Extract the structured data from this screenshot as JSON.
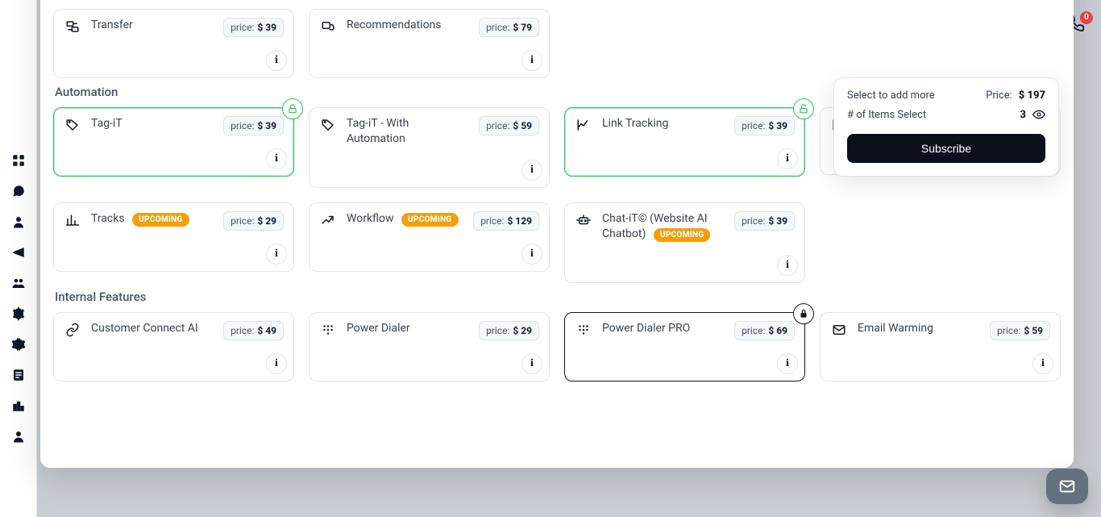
{
  "summary": {
    "select_label": "Select to add more",
    "price_label": "Price:",
    "price_value": "$ 197",
    "items_label": "# of Items Select",
    "items_value": "3",
    "subscribe_label": "Subscribe"
  },
  "badge_upcoming": "UPCOMING",
  "info_glyph": "i",
  "price_prefix": "price:",
  "sections": {
    "top_row1": [
      {
        "id": "blank1",
        "title": "",
        "price": ""
      },
      {
        "id": "blank2",
        "title": "",
        "price": ""
      },
      {
        "id": "blank3",
        "title": "",
        "price": ""
      },
      {
        "id": "blank4",
        "title": "",
        "price": ""
      }
    ],
    "top_row2": [
      {
        "id": "transfer",
        "title": "Transfer",
        "price": "$ 39"
      },
      {
        "id": "recommendations",
        "title": "Recommendations",
        "price": "$ 79"
      }
    ],
    "automation_title": "Automation",
    "automation": [
      {
        "id": "tagit",
        "title": "Tag-iT",
        "price": "$ 39",
        "selected": true
      },
      {
        "id": "tagit-auto",
        "title": "Tag-iT - With Automation",
        "price": "$ 59"
      },
      {
        "id": "link-tracking",
        "title": "Link Tracking",
        "price": "$ 39",
        "selected": true
      },
      {
        "id": "analytics",
        "title": "",
        "price": ""
      }
    ],
    "automation_row2": [
      {
        "id": "tracks",
        "title": "Tracks",
        "price": "$ 29",
        "upcoming": true
      },
      {
        "id": "workflow",
        "title": "Workflow",
        "price": "$ 129",
        "upcoming": true
      },
      {
        "id": "chatit",
        "title": "Chat-iT© (Website AI Chatbot)",
        "price": "$ 39",
        "upcoming": true
      }
    ],
    "internal_title": "Internal Features",
    "internal": [
      {
        "id": "cca",
        "title": "Customer Connect AI",
        "price": "$ 49"
      },
      {
        "id": "dialer",
        "title": "Power Dialer",
        "price": "$ 29"
      },
      {
        "id": "dialer-pro",
        "title": "Power Dialer PRO",
        "price": "$ 69",
        "locked": true
      },
      {
        "id": "email-warming",
        "title": "Email Warming",
        "price": "$ 59"
      }
    ]
  },
  "notifications": {
    "phone_badge": "0"
  }
}
